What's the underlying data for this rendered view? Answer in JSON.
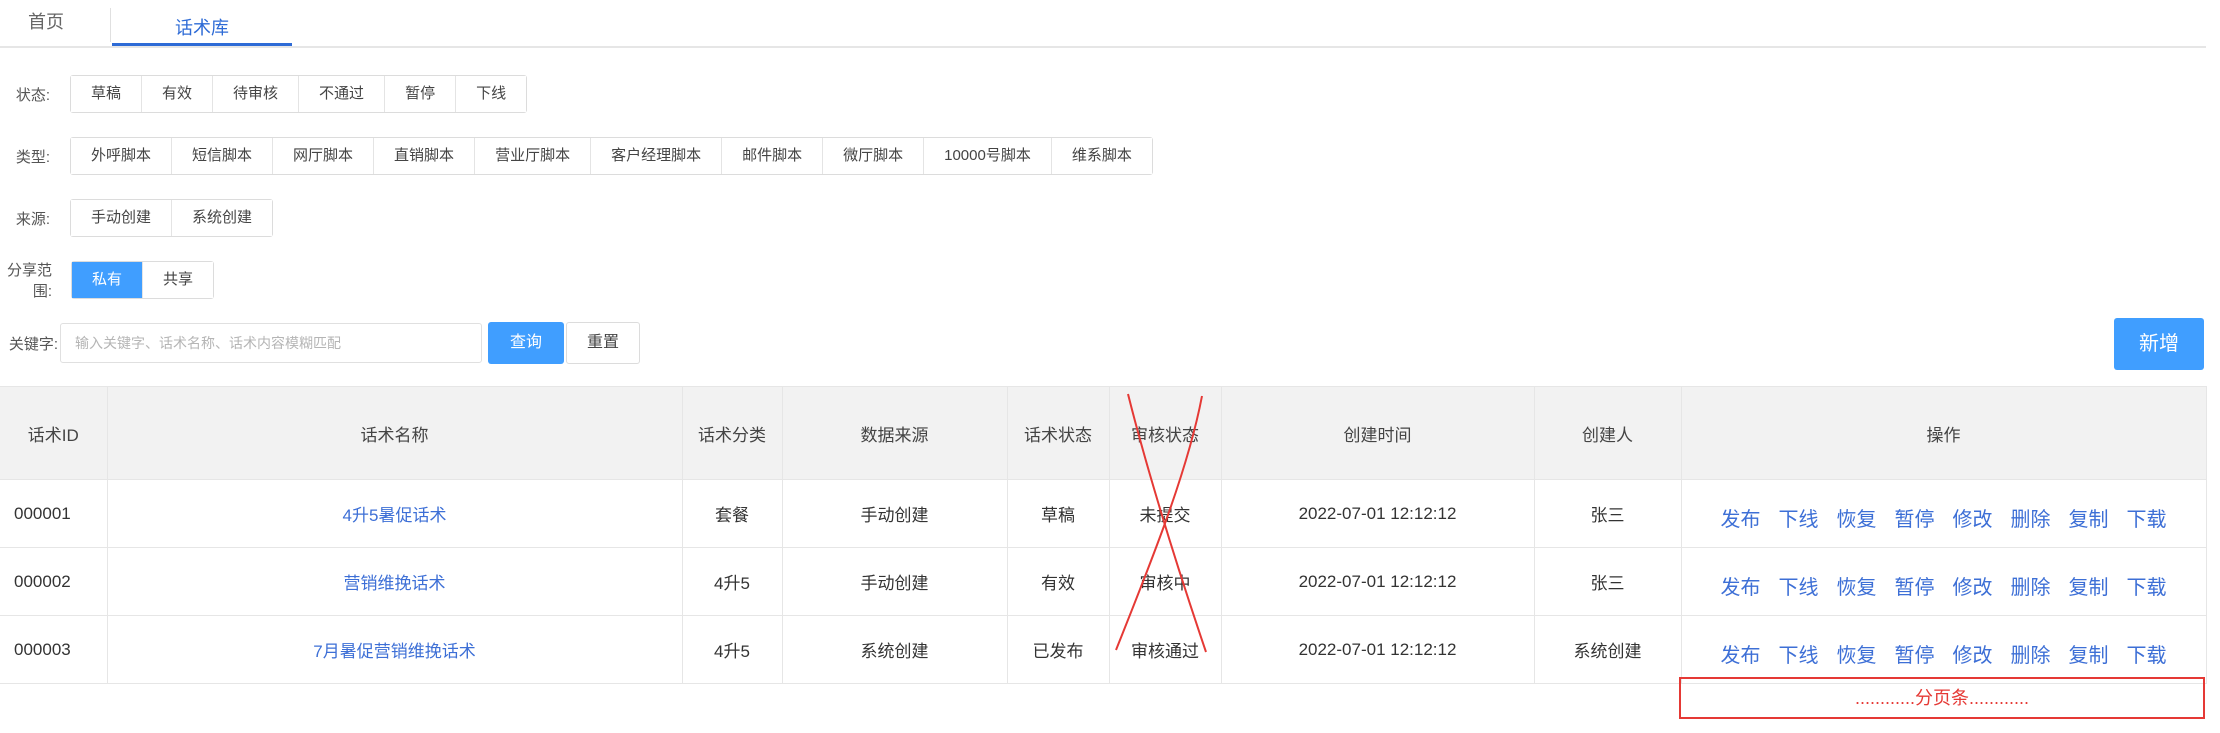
{
  "tabs": {
    "home": "首页",
    "active": "话术库"
  },
  "filters": {
    "status": {
      "label": "状态:",
      "options": [
        "草稿",
        "有效",
        "待审核",
        "不通过",
        "暂停",
        "下线"
      ]
    },
    "type": {
      "label": "类型:",
      "options": [
        "外呼脚本",
        "短信脚本",
        "网厅脚本",
        "直销脚本",
        "营业厅脚本",
        "客户经理脚本",
        "邮件脚本",
        "微厅脚本",
        "10000号脚本",
        "维系脚本"
      ]
    },
    "source": {
      "label": "来源:",
      "options": [
        "手动创建",
        "系统创建"
      ]
    },
    "scope": {
      "label": "分享范围:",
      "options": [
        "私有",
        "共享"
      ],
      "selected": "私有"
    }
  },
  "keyword": {
    "label": "关键字:",
    "placeholder": "输入关键字、话术名称、话术内容模糊匹配",
    "query": "查询",
    "reset": "重置"
  },
  "new_button": "新增",
  "table": {
    "headers": [
      "话术ID",
      "话术名称",
      "话术分类",
      "数据来源",
      "话术状态",
      "审核状态",
      "创建时间",
      "创建人",
      "操作"
    ],
    "rows": [
      [
        "000001",
        "4升5暑促话术",
        "套餐",
        "手动创建",
        "草稿",
        "未提交",
        "2022-07-01  12:12:12",
        "张三"
      ],
      [
        "000002",
        "营销维挽话术",
        "4升5",
        "手动创建",
        "有效",
        "审核中",
        "2022-07-01  12:12:12",
        "张三"
      ],
      [
        "000003",
        "7月暑促营销维挽话术",
        "4升5",
        "系统创建",
        "已发布",
        "审核通过",
        "2022-07-01  12:12:12",
        "系统创建"
      ]
    ],
    "actions": [
      "发布",
      "下线",
      "恢复",
      "暂停",
      "修改",
      "删除",
      "复制",
      "下载"
    ]
  },
  "pager_note": "............分页条............",
  "colors": {
    "accent": "#409eff",
    "link": "#3d6fd6",
    "annotation": "#e53935"
  }
}
